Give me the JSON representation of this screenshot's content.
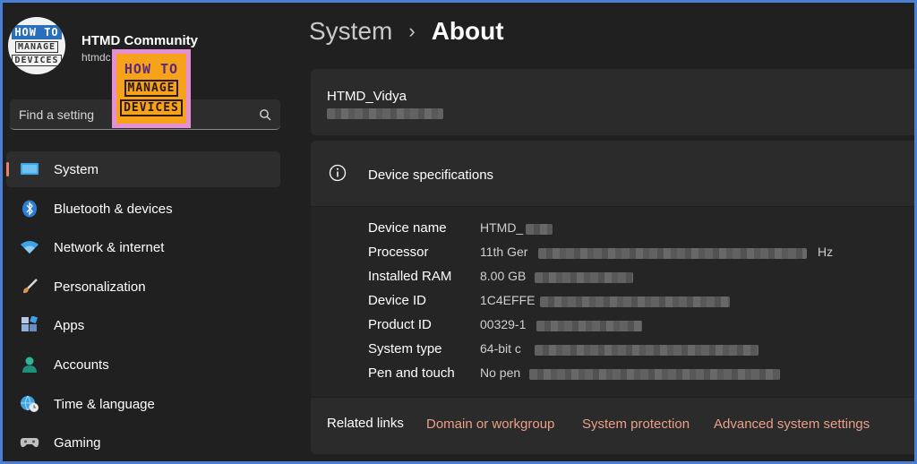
{
  "profile": {
    "name": "HTMD Community",
    "email": "htmdc",
    "avatar_text": [
      "HOW TO",
      "MANAGE",
      "DEVICES"
    ]
  },
  "watermark": {
    "line1": "HOW TO",
    "line2": "MANAGE",
    "line3": "DEVICES"
  },
  "search": {
    "placeholder": "Find a setting",
    "icon": "search-icon"
  },
  "sidebar": {
    "items": [
      {
        "label": "System",
        "icon": "system-monitor-icon",
        "active": true
      },
      {
        "label": "Bluetooth & devices",
        "icon": "bluetooth-icon",
        "active": false
      },
      {
        "label": "Network & internet",
        "icon": "wifi-icon",
        "active": false
      },
      {
        "label": "Personalization",
        "icon": "paintbrush-icon",
        "active": false
      },
      {
        "label": "Apps",
        "icon": "apps-icon",
        "active": false
      },
      {
        "label": "Accounts",
        "icon": "accounts-icon",
        "active": false
      },
      {
        "label": "Time & language",
        "icon": "globe-clock-icon",
        "active": false
      },
      {
        "label": "Gaming",
        "icon": "gamepad-icon",
        "active": false
      }
    ]
  },
  "breadcrumb": {
    "parent": "System",
    "separator": "›",
    "current": "About"
  },
  "device": {
    "name": "HTMD_Vidya"
  },
  "specs": {
    "title": "Device specifications",
    "rows": [
      {
        "label": "Device name",
        "value": "HTMD_",
        "suffix": ""
      },
      {
        "label": "Processor",
        "value": "11th Ger",
        "suffix": "Hz"
      },
      {
        "label": "Installed RAM",
        "value": "8.00 GB",
        "suffix": ""
      },
      {
        "label": "Device ID",
        "value": "1C4EFFE",
        "suffix": ""
      },
      {
        "label": "Product ID",
        "value": "00329-1",
        "suffix": ""
      },
      {
        "label": "System type",
        "value": "64-bit c",
        "suffix": ""
      },
      {
        "label": "Pen and touch",
        "value": "No pen",
        "suffix": ""
      }
    ]
  },
  "related": {
    "label": "Related links",
    "links": [
      "Domain or workgroup",
      "System protection",
      "Advanced system settings"
    ]
  },
  "colors": {
    "accent_link": "#e8a088",
    "active_indicator": "#e8826b",
    "frame_border": "#4a7fd4",
    "background": "#202020"
  }
}
